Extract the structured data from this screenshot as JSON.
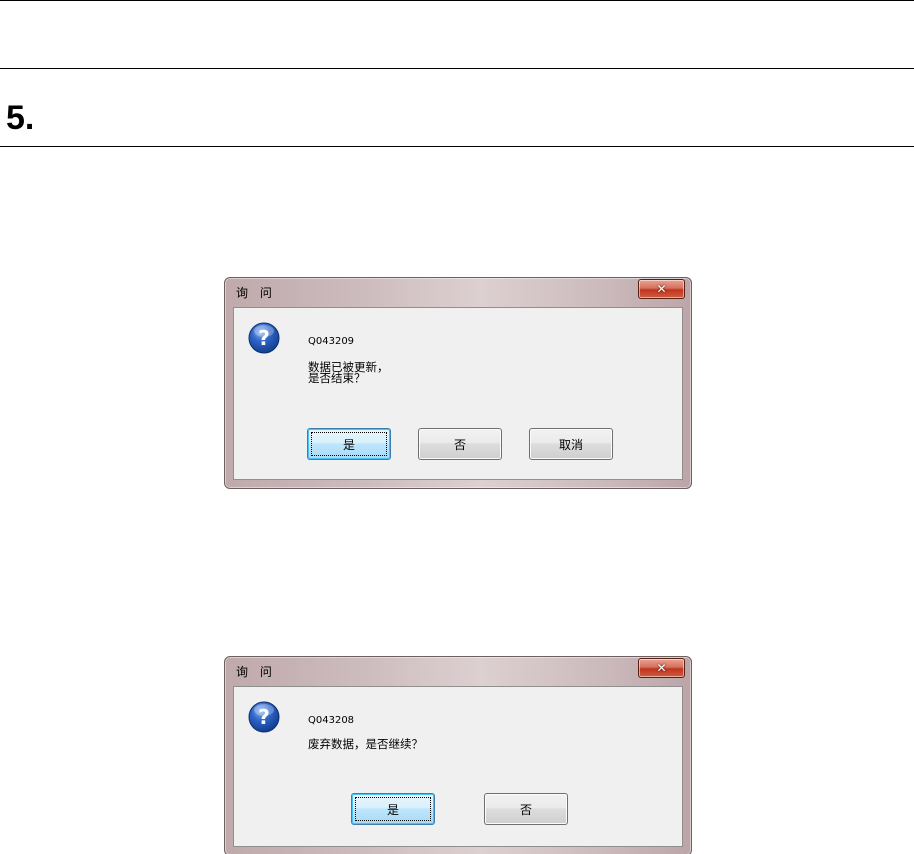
{
  "section": {
    "number": "5."
  },
  "dialogs": [
    {
      "title": "询 问",
      "code": "Q043209",
      "message_lines": [
        "数据已被更新，",
        "是否结束？"
      ],
      "buttons": [
        "是",
        "否",
        "取消"
      ]
    },
    {
      "title": "询 问",
      "code": "Q043208",
      "message_lines": [
        "废弃数据，是否继续？"
      ],
      "buttons": [
        "是",
        "否"
      ]
    }
  ],
  "icons": {
    "close": "close-icon",
    "question": "question-icon"
  },
  "colors": {
    "close_button": "#c0341f",
    "default_button_border": "#3c7fb1",
    "question_icon": "#1f55b8"
  }
}
